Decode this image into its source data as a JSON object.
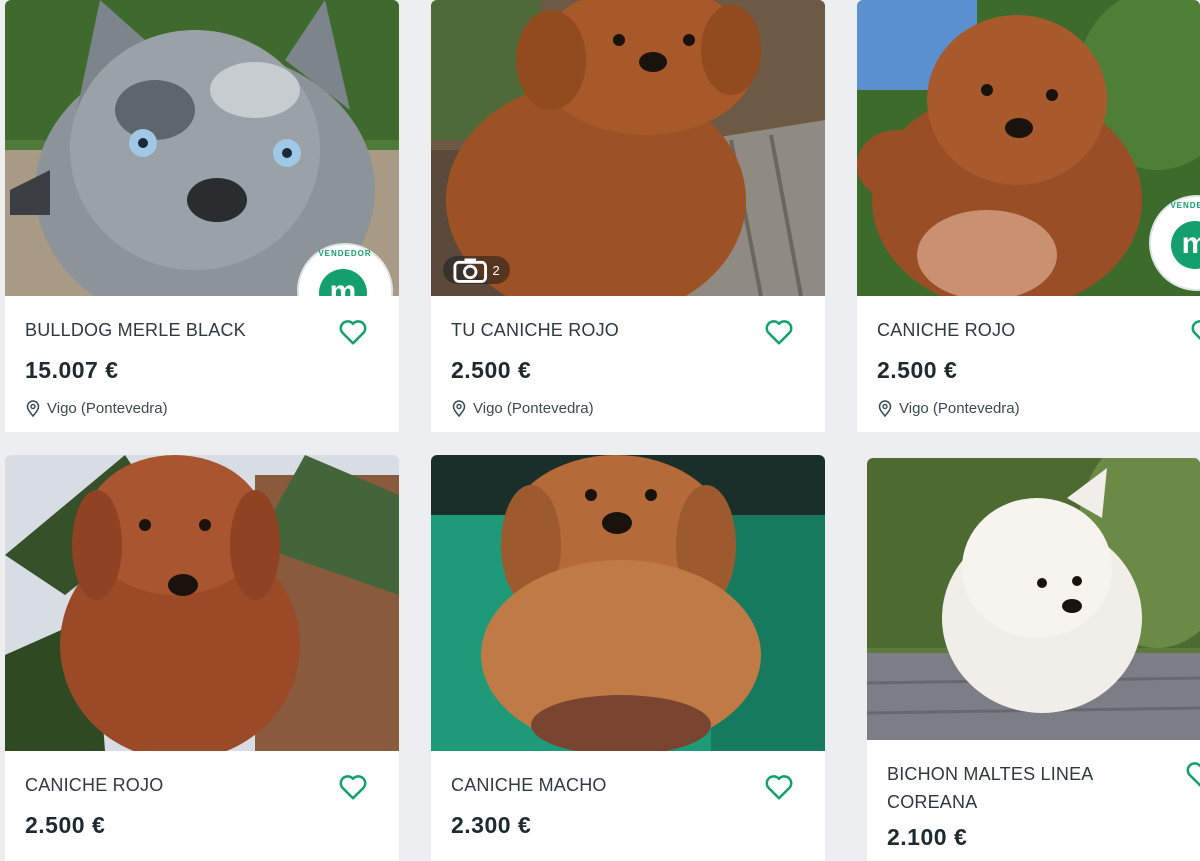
{
  "accent_color": "#13a06d",
  "badge": {
    "letter": "m",
    "ring_text": "VENDEDOR"
  },
  "listings": [
    {
      "title": "BULLDOG MERLE BLACK",
      "price": "15.007 €",
      "location": "Vigo (Pontevedra)",
      "image": "blue merle french bulldog puppy"
    },
    {
      "title": "TU CANICHE ROJO",
      "price": "2.500 €",
      "location": "Vigo (Pontevedra)",
      "image": "red poodle puppy on wooden deck",
      "photo_count": "2"
    },
    {
      "title": "CANICHE ROJO",
      "price": "2.500 €",
      "location": "Vigo (Pontevedra)",
      "image": "red poodle puppy held in hand"
    },
    {
      "title": "CANICHE ROJO",
      "price": "2.500 €",
      "location": "",
      "image": "red poodle puppy held in front of palm tree"
    },
    {
      "title": "CANICHE MACHO",
      "price": "2.300 €",
      "location": "",
      "image": "apricot poodle puppy held against green wall"
    },
    {
      "title": "BICHON MALTES LINEA",
      "title_line2": "COREANA",
      "price": "2.100 €",
      "location": "",
      "image": "white maltese puppy on wooden table"
    }
  ],
  "icons": [
    "heart-icon",
    "location-pin-icon",
    "camera-icon"
  ]
}
